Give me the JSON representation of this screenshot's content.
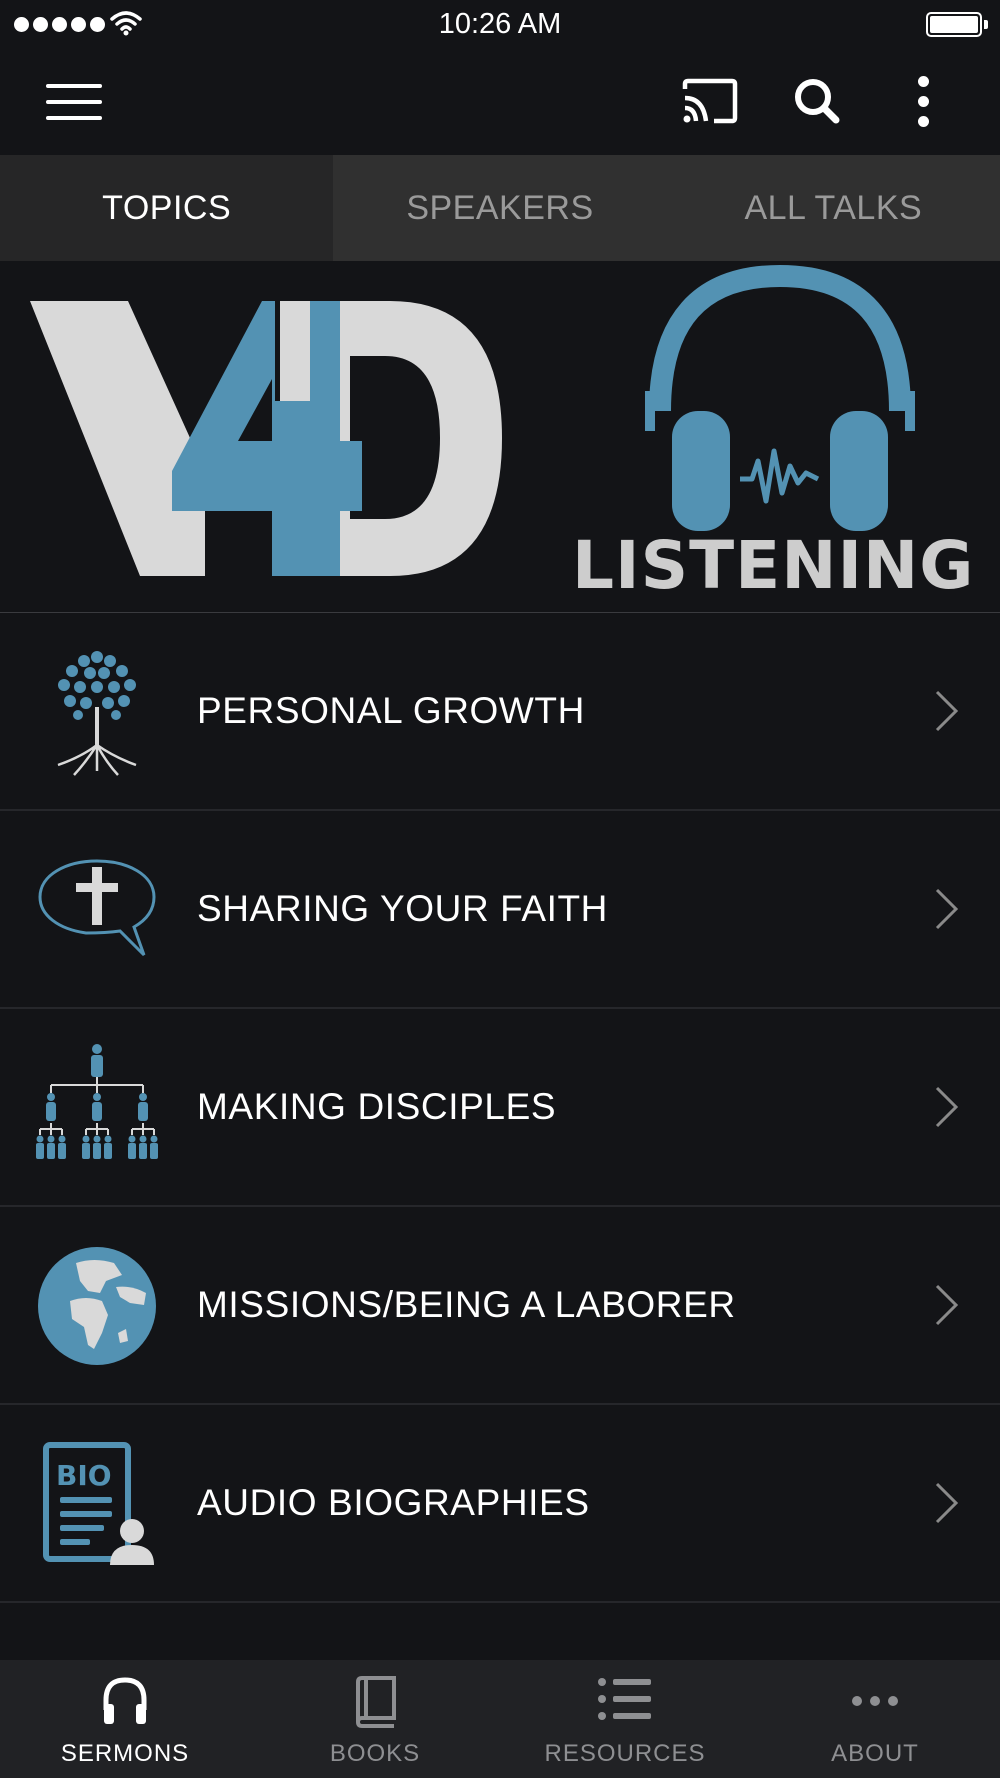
{
  "status_bar": {
    "time": "10:26 AM",
    "signal_icon": "signal-dots-icon",
    "wifi_icon": "wifi-icon",
    "battery_icon": "battery-icon"
  },
  "app_bar": {
    "menu_icon": "hamburger-menu-icon",
    "cast_icon": "cast-icon",
    "search_icon": "search-icon",
    "more_icon": "more-vertical-icon"
  },
  "tabs": [
    {
      "label": "TOPICS",
      "active": true
    },
    {
      "label": "SPEAKERS",
      "active": false
    },
    {
      "label": "ALL TALKS",
      "active": false
    }
  ],
  "banner": {
    "logo_text": "V4D",
    "subtitle": "LISTENING",
    "icon": "headphones-icon"
  },
  "topics": [
    {
      "label": "PERSONAL GROWTH",
      "icon": "tree-icon"
    },
    {
      "label": "SHARING YOUR FAITH",
      "icon": "speech-bubble-cross-icon"
    },
    {
      "label": "MAKING DISCIPLES",
      "icon": "people-hierarchy-icon"
    },
    {
      "label": "MISSIONS/BEING A LABORER",
      "icon": "globe-icon"
    },
    {
      "label": "AUDIO BIOGRAPHIES",
      "icon": "bio-document-icon"
    }
  ],
  "bottom_nav": [
    {
      "label": "SERMONS",
      "icon": "headphones-icon",
      "active": true
    },
    {
      "label": "BOOKS",
      "icon": "book-icon",
      "active": false
    },
    {
      "label": "RESOURCES",
      "icon": "list-icon",
      "active": false
    },
    {
      "label": "ABOUT",
      "icon": "more-horizontal-icon",
      "active": false
    }
  ],
  "colors": {
    "accent_blue": "#5392b3",
    "logo_gray": "#d9d9d9",
    "background": "#131417",
    "tab_bar": "#303030",
    "nav_bar": "#212225"
  }
}
